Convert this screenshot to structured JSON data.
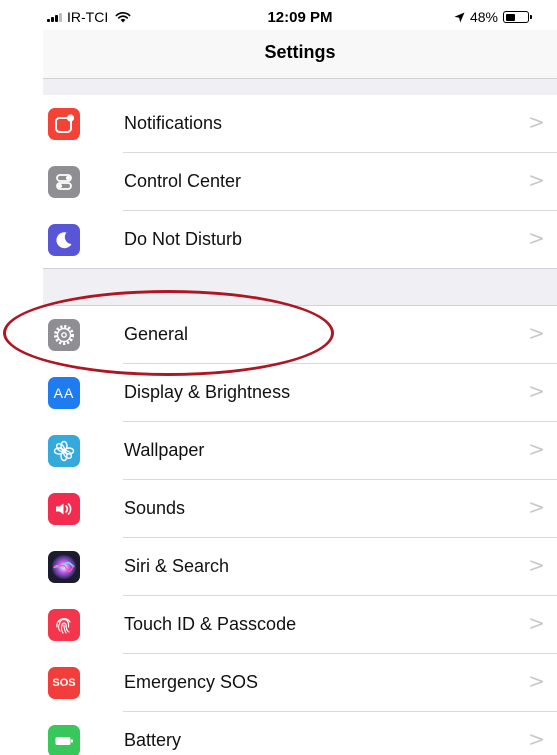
{
  "status_bar": {
    "carrier": "IR-TCI",
    "time": "12:09 PM",
    "battery_percent": "48%",
    "battery_level": 0.48
  },
  "nav": {
    "title": "Settings"
  },
  "groups": [
    {
      "items": [
        {
          "label": "Notifications",
          "icon": "notifications-icon",
          "color": "#f44336"
        },
        {
          "label": "Control Center",
          "icon": "control-center-icon",
          "color": "#8e8e93"
        },
        {
          "label": "Do Not Disturb",
          "icon": "moon-icon",
          "color": "#5856d6"
        }
      ]
    },
    {
      "items": [
        {
          "label": "General",
          "icon": "gear-icon",
          "color": "#8e8e93"
        },
        {
          "label": "Display & Brightness",
          "icon": "display-brightness-icon",
          "color": "#1e7cf0",
          "icon_text": "AA"
        },
        {
          "label": "Wallpaper",
          "icon": "wallpaper-icon",
          "color": "#34aadc"
        },
        {
          "label": "Sounds",
          "icon": "speaker-icon",
          "color": "#f22c4f"
        },
        {
          "label": "Siri & Search",
          "icon": "siri-icon",
          "color": "#1c1c2e"
        },
        {
          "label": "Touch ID & Passcode",
          "icon": "fingerprint-icon",
          "color": "#f4364c"
        },
        {
          "label": "Emergency SOS",
          "icon": "sos-icon",
          "color": "#f33d3a",
          "icon_text": "SOS"
        },
        {
          "label": "Battery",
          "icon": "battery-icon",
          "color": "#38c759"
        }
      ]
    }
  ],
  "chevron": ">",
  "annotation": {
    "highlight_color": "#b01522"
  }
}
